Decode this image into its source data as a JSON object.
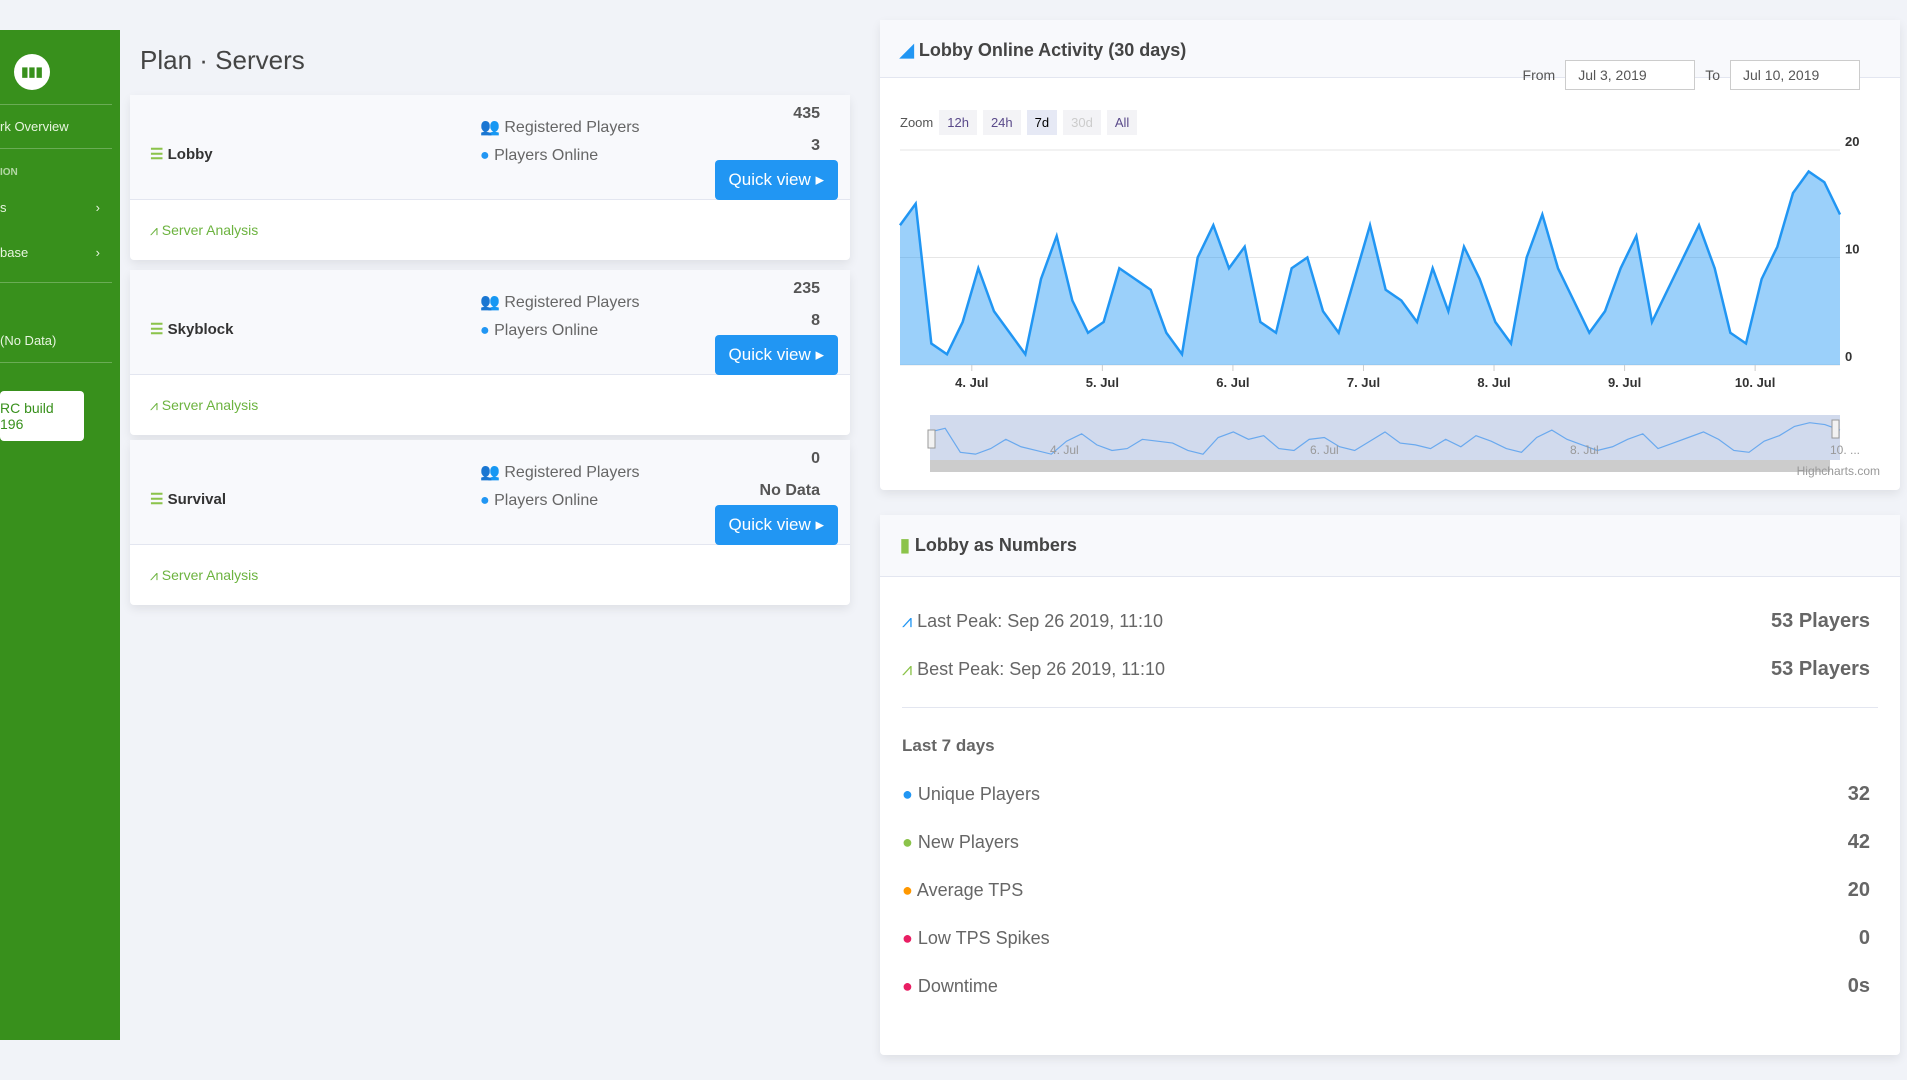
{
  "sidebar": {
    "items": [
      {
        "label": "rk Overview"
      },
      {
        "label": "ION",
        "header": true
      },
      {
        "label": "s",
        "chevron": true
      },
      {
        "label": "base",
        "chevron": true
      },
      {
        "label": "(No Data)"
      }
    ],
    "build": "RC build 196"
  },
  "page_title": "Plan · Servers",
  "servers": [
    {
      "name": "Lobby",
      "registered_label": "Registered Players",
      "online_label": "Players Online",
      "registered": "435",
      "online": "3",
      "analysis": "Server Analysis",
      "quick_view": "Quick view"
    },
    {
      "name": "Skyblock",
      "registered_label": "Registered Players",
      "online_label": "Players Online",
      "registered": "235",
      "online": "8",
      "analysis": "Server Analysis",
      "quick_view": "Quick view"
    },
    {
      "name": "Survival",
      "registered_label": "Registered Players",
      "online_label": "Players Online",
      "registered": "0",
      "online": "No Data",
      "analysis": "Server Analysis",
      "quick_view": "Quick view"
    }
  ],
  "activity": {
    "title": "Lobby Online Activity (30 days)",
    "zoom_label": "Zoom",
    "zoom_buttons": [
      "12h",
      "24h",
      "7d",
      "30d",
      "All"
    ],
    "zoom_selected": "7d",
    "from_label": "From",
    "from": "Jul 3, 2019",
    "to_label": "To",
    "to": "Jul 10, 2019",
    "credit": "Highcharts.com",
    "navigator_labels": [
      "4. Jul",
      "6. Jul",
      "8. Jul",
      "10. ..."
    ]
  },
  "chart_data": {
    "type": "area",
    "x_ticks": [
      "4. Jul",
      "5. Jul",
      "6. Jul",
      "7. Jul",
      "8. Jul",
      "9. Jul",
      "10. Jul"
    ],
    "y_ticks": [
      0,
      10,
      20
    ],
    "ylim": [
      0,
      20
    ],
    "x": "3-hour steps Jul 3 – Jul 10, 2019",
    "values": [
      13,
      15,
      2,
      1,
      4,
      9,
      5,
      3,
      1,
      8,
      12,
      6,
      3,
      4,
      9,
      8,
      7,
      3,
      1,
      10,
      13,
      9,
      11,
      4,
      3,
      9,
      10,
      5,
      3,
      8,
      13,
      7,
      6,
      4,
      9,
      5,
      11,
      8,
      4,
      2,
      10,
      14,
      9,
      6,
      3,
      5,
      9,
      12,
      4,
      7,
      10,
      13,
      9,
      3,
      2,
      8,
      11,
      16,
      18,
      17,
      14
    ],
    "color": "#2196f3"
  },
  "numbers": {
    "title": "Lobby as Numbers",
    "last_peak": "Last Peak: Sep 26 2019, 11:10",
    "last_peak_value": "53 Players",
    "best_peak": "Best Peak: Sep 26 2019, 11:10",
    "best_peak_value": "53 Players",
    "section": "Last 7 days",
    "rows": [
      {
        "label": "Unique Players",
        "value": "32",
        "icon": "users-icon",
        "color": "#2196f3"
      },
      {
        "label": "New Players",
        "value": "42",
        "icon": "user-plus-icon",
        "color": "#8bc34a"
      },
      {
        "label": "Average TPS",
        "value": "20",
        "icon": "tachometer-icon",
        "color": "#ff9800"
      },
      {
        "label": "Low TPS Spikes",
        "value": "0",
        "icon": "exclamation-circle-icon",
        "color": "#e91e63"
      },
      {
        "label": "Downtime",
        "value": "0s",
        "icon": "power-off-icon",
        "color": "#e91e63"
      }
    ]
  }
}
